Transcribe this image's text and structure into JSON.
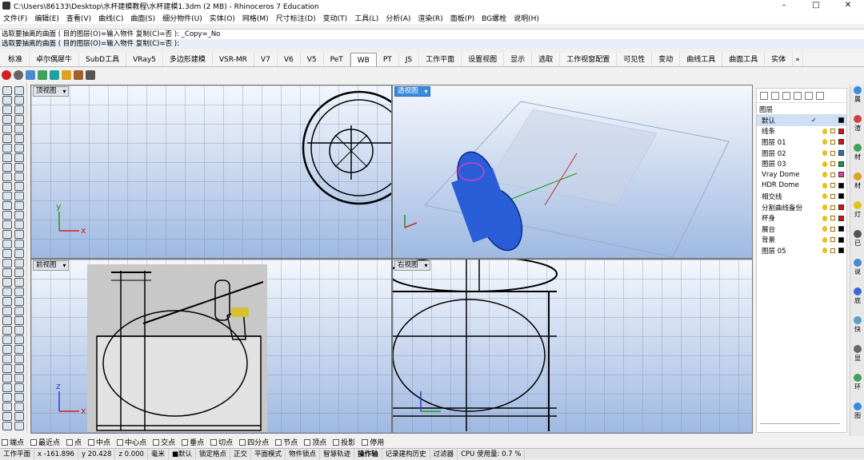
{
  "window": {
    "title": "C:\\Users\\86133\\Desktop\\水杯建模教程\\水杯建模1.3dm (2 MB) - Rhinoceros 7 Education",
    "min": "–",
    "max": "□",
    "close": "✕"
  },
  "menu": [
    "文件(F)",
    "编辑(E)",
    "查看(V)",
    "曲线(C)",
    "曲面(S)",
    "细分物件(U)",
    "实体(O)",
    "网格(M)",
    "尺寸标注(D)",
    "变动(T)",
    "工具(L)",
    "分析(A)",
    "渲染(R)",
    "面板(P)",
    "BG螺栓",
    "说明(H)"
  ],
  "command_history": [
    "选取要抽离的曲面 ( 目的图层(O)=输入物件  复制(C)=否 ): _Copy=_No",
    "选取要抽离的曲面 ( 目的图层(O)=输入物件  复制(C)=否 ):"
  ],
  "tabs": [
    "标准",
    "卓尔偶犀牛",
    "SubD工具",
    "VRay5",
    "多边形建模",
    "VSR-MR",
    "V7",
    "V6",
    "V5",
    "PeT",
    "WB",
    "PT",
    "JS",
    "工作平面",
    "设置视图",
    "显示",
    "选取",
    "工作视窗配置",
    "可见性",
    "变动",
    "曲线工具",
    "曲面工具",
    "实体"
  ],
  "tabs_more": "»",
  "active_tab": "WB",
  "viewports": {
    "top": "顶视图",
    "perspective": "透视图",
    "front": "前视图",
    "right": "右视图",
    "axis_x": "x",
    "axis_y": "y",
    "axis_z": "z"
  },
  "layers": {
    "header": "图层",
    "rows": [
      {
        "name": "默认",
        "color": "#000000",
        "current": true,
        "check": "✓"
      },
      {
        "name": "线条",
        "color": "#e01010"
      },
      {
        "name": "图层 01",
        "color": "#e01010"
      },
      {
        "name": "图层 02",
        "color": "#2a70d0"
      },
      {
        "name": "图层 03",
        "color": "#10a040"
      },
      {
        "name": "Vray Dome",
        "color": "#e040a0"
      },
      {
        "name": "HDR Dome",
        "color": "#000000"
      },
      {
        "name": "相交线",
        "color": "#000000"
      },
      {
        "name": "分割曲线备份",
        "color": "#e01010"
      },
      {
        "name": "杯身",
        "color": "#e01010"
      },
      {
        "name": "展台",
        "color": "#000000"
      },
      {
        "name": "背景",
        "color": "#000000"
      },
      {
        "name": "图层 05",
        "color": "#000000"
      }
    ]
  },
  "side_tabs": [
    "属",
    "渲",
    "材",
    "材",
    "灯",
    "已",
    "说",
    "底",
    "快",
    "显",
    "环",
    "图"
  ],
  "osnaps": [
    "端点",
    "最近点",
    "点",
    "中点",
    "中心点",
    "交点",
    "垂点",
    "切点",
    "四分点",
    "节点",
    "顶点",
    "投影",
    "停用"
  ],
  "status": {
    "cplane": "工作平面",
    "x": "x -161.896",
    "y": "y 20.428",
    "z": "z 0.000",
    "units": "毫米",
    "layer": "■默认",
    "items": [
      "锁定格点",
      "正交",
      "平面模式",
      "物件锁点",
      "智慧轨迹",
      "操作轴",
      "记录建构历史",
      "过滤器",
      "CPU 使用量: 0.7 %"
    ]
  }
}
